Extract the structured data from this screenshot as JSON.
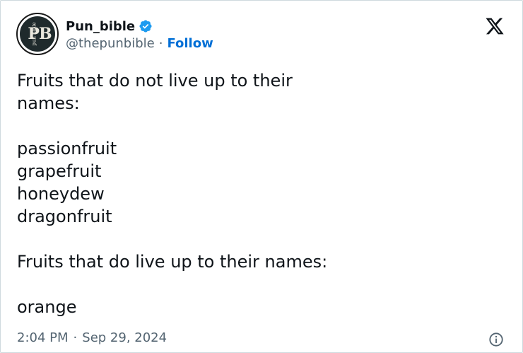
{
  "author": {
    "display_name": "Pun_bible",
    "handle": "@thepunbible",
    "follow_label": "Follow",
    "separator": "·",
    "avatar_monogram": "PB",
    "avatar_side_text": "pun bible",
    "verified_icon": "verified-badge-icon",
    "verified_color": "#1d9bf0"
  },
  "platform": {
    "logo_icon": "x-logo-icon"
  },
  "tweet": {
    "lines": [
      "Fruits that do not live up to their",
      "names:",
      "",
      "passionfruit",
      "grapefruit",
      "honeydew",
      "dragonfruit",
      "",
      "Fruits that do live up to their names:",
      "",
      "orange"
    ]
  },
  "footer": {
    "time": "2:04 PM",
    "separator": "·",
    "date": "Sep 29, 2024",
    "info_icon": "info-icon"
  },
  "colors": {
    "text": "#0f1419",
    "secondary": "#536471",
    "link": "#006fd6",
    "border": "#cfd9de"
  }
}
